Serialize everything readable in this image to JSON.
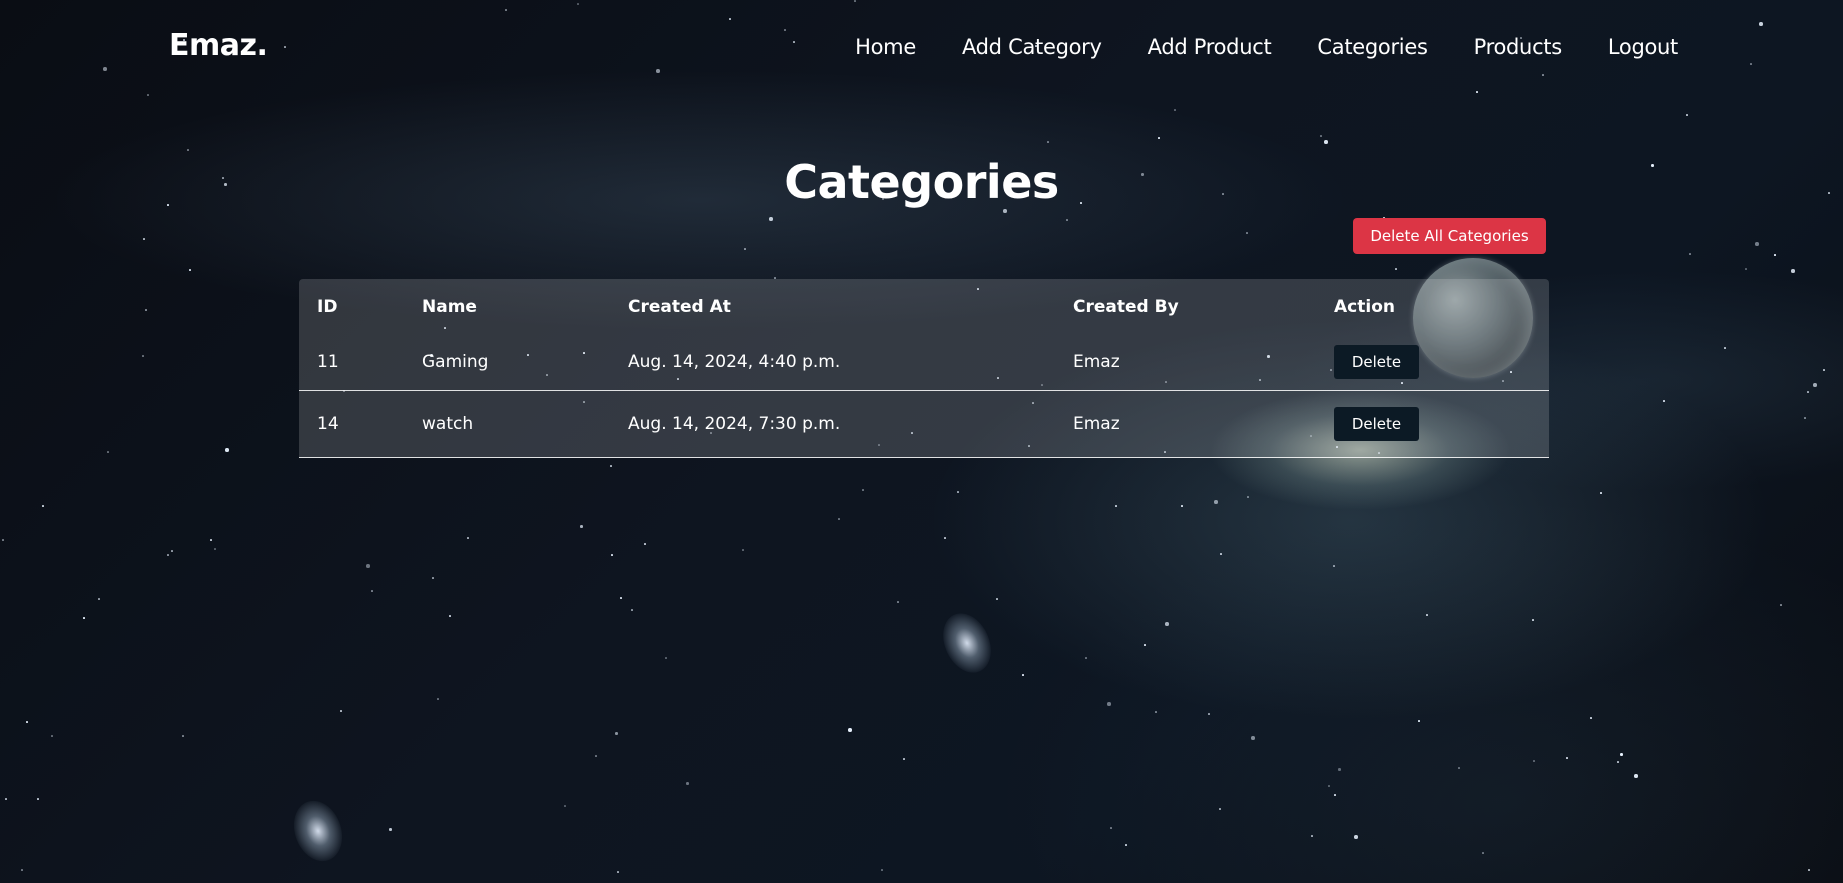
{
  "navbar": {
    "brand": "Emaz.",
    "links": [
      {
        "label": "Home"
      },
      {
        "label": "Add Category"
      },
      {
        "label": "Add Product"
      },
      {
        "label": "Categories"
      },
      {
        "label": "Products"
      },
      {
        "label": "Logout"
      }
    ]
  },
  "main": {
    "title": "Categories",
    "delete_all_label": "Delete All Categories",
    "table": {
      "headers": [
        "ID",
        "Name",
        "Created At",
        "Created By",
        "Action"
      ],
      "rows": [
        {
          "id": "11",
          "name": "Gaming",
          "created_at": "Aug. 14, 2024, 4:40 p.m.",
          "created_by": "Emaz",
          "action": "Delete"
        },
        {
          "id": "14",
          "name": "watch",
          "created_at": "Aug. 14, 2024, 7:30 p.m.",
          "created_by": "Emaz",
          "action": "Delete"
        }
      ]
    }
  },
  "colors": {
    "danger": "#dc3545",
    "dark_button": "#0c1a25",
    "text": "#ffffff"
  }
}
